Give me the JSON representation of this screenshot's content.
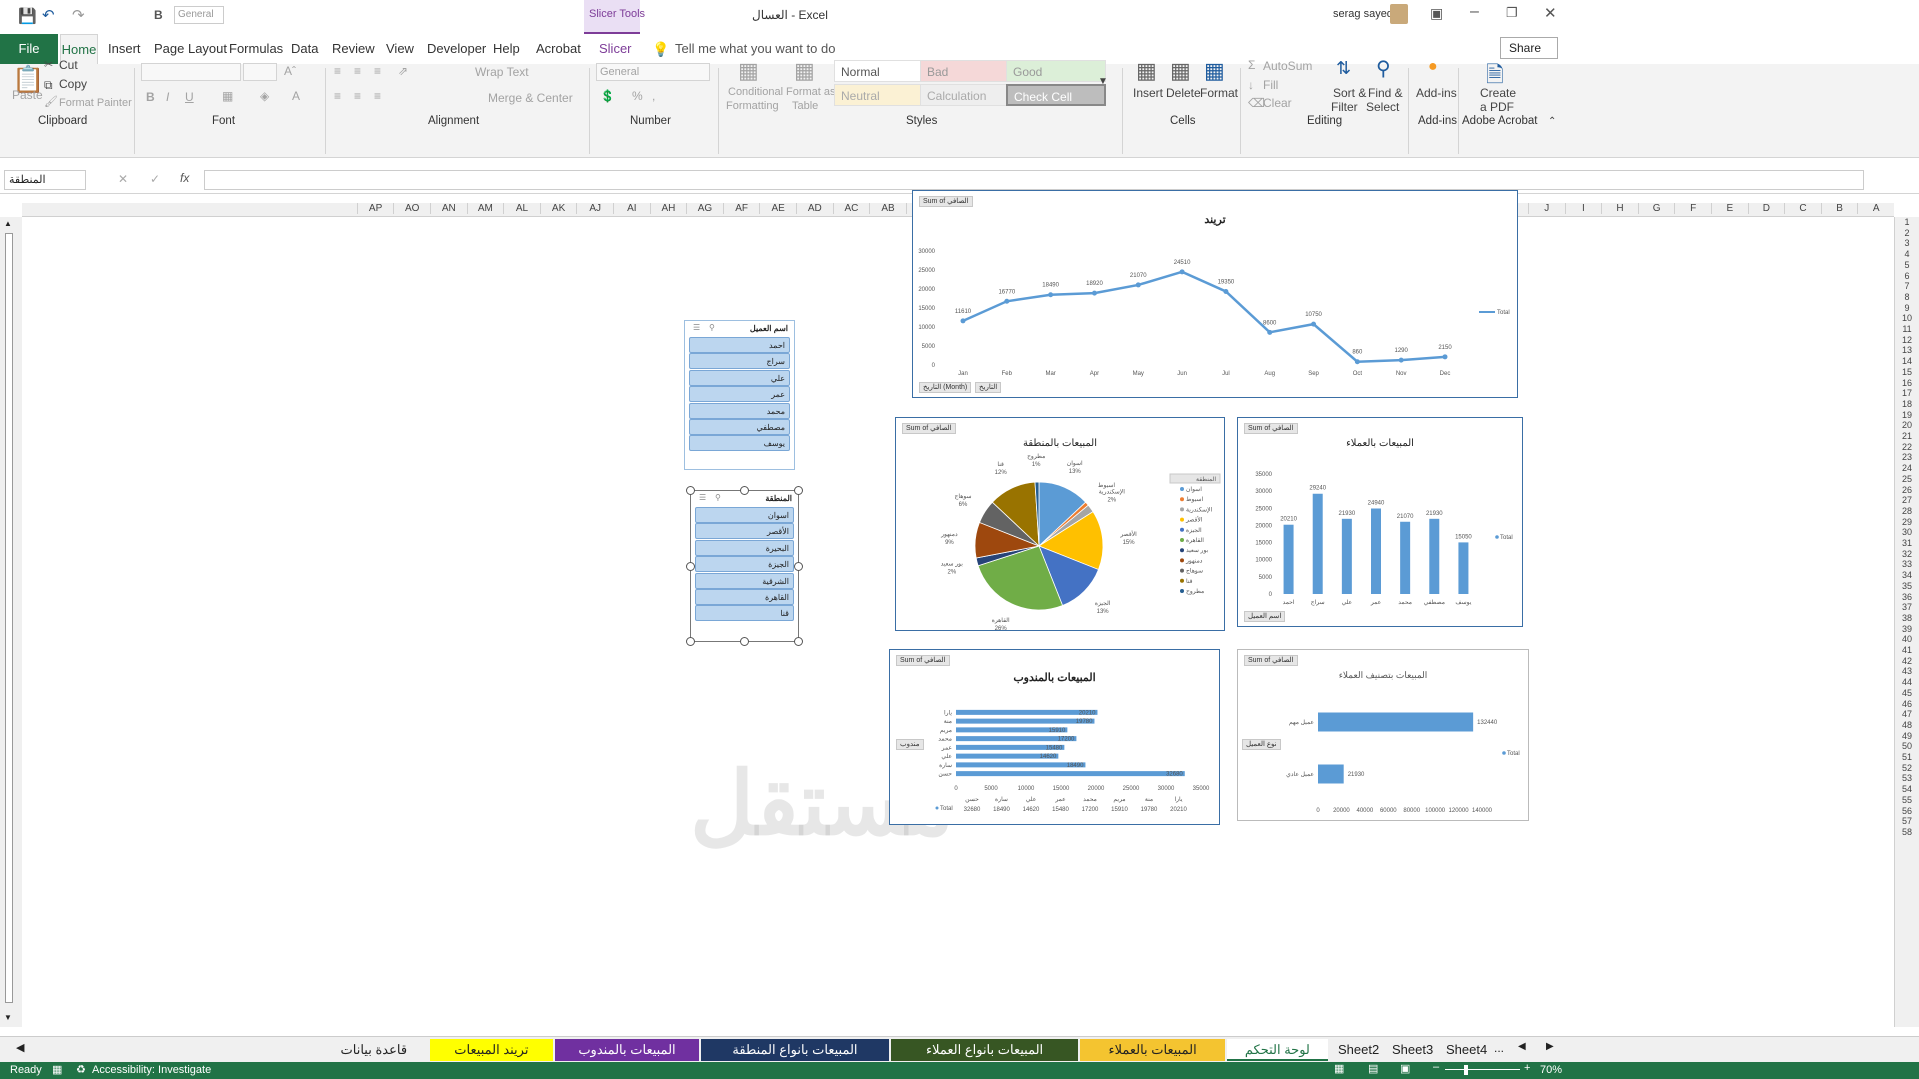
{
  "window": {
    "title": "العسال - Excel",
    "contextual": "Slicer Tools",
    "user": "serag sayed",
    "quick_font": "General"
  },
  "tabs": [
    "Home",
    "Insert",
    "Page Layout",
    "Formulas",
    "Data",
    "Review",
    "View",
    "Developer",
    "Help",
    "Acrobat",
    "Slicer"
  ],
  "file_tab": "File",
  "tell_me": "Tell me what you want to do",
  "share": "Share",
  "ribbon": {
    "clipboard": {
      "group": "Clipboard",
      "paste": "Paste",
      "cut": "Cut",
      "copy": "Copy",
      "painter": "Format Painter"
    },
    "font": {
      "group": "Font"
    },
    "alignment": {
      "group": "Alignment",
      "wrap": "Wrap Text",
      "merge": "Merge & Center"
    },
    "number": {
      "group": "Number",
      "format": "General"
    },
    "styles": {
      "group": "Styles",
      "cond": "Conditional",
      "cond2": "Formatting",
      "fmt_table": "Format as",
      "fmt_table2": "Table",
      "normal": "Normal",
      "bad": "Bad",
      "good": "Good",
      "neutral": "Neutral",
      "calculation": "Calculation",
      "check": "Check Cell"
    },
    "cells": {
      "group": "Cells",
      "insert": "Insert",
      "delete": "Delete",
      "format": "Format"
    },
    "editing": {
      "group": "Editing",
      "autosum": "AutoSum",
      "fill": "Fill",
      "clear": "Clear",
      "sort": "Sort &",
      "sort2": "Filter",
      "find": "Find &",
      "find2": "Select"
    },
    "addins": {
      "group": "Add-ins",
      "label": "Add-ins"
    },
    "acrobat": {
      "group": "Adobe Acrobat",
      "create": "Create",
      "create2": "a PDF"
    }
  },
  "namebox": "المنطقة",
  "columns": [
    "A",
    "B",
    "C",
    "D",
    "E",
    "F",
    "G",
    "H",
    "I",
    "J",
    "K",
    "L",
    "M",
    "N",
    "O",
    "P",
    "Q",
    "R",
    "S",
    "T",
    "U",
    "V",
    "W",
    "X",
    "Y",
    "Z",
    "AA",
    "AB",
    "AC",
    "AD",
    "AE",
    "AF",
    "AG",
    "AH",
    "AI",
    "AJ",
    "AK",
    "AL",
    "AM",
    "AN",
    "AO",
    "AP"
  ],
  "rows": [
    "1",
    "2",
    "3",
    "4",
    "5",
    "6",
    "7",
    "8",
    "9",
    "10",
    "11",
    "12",
    "13",
    "14",
    "15",
    "16",
    "17",
    "18",
    "19",
    "20",
    "21",
    "22",
    "23",
    "24",
    "25",
    "26",
    "27",
    "28",
    "29",
    "30",
    "31",
    "32",
    "33",
    "34",
    "35",
    "36",
    "37",
    "38",
    "39",
    "40",
    "41",
    "42",
    "43",
    "44",
    "45",
    "46",
    "47",
    "48",
    "49",
    "50",
    "51",
    "52",
    "53",
    "54",
    "55",
    "56",
    "57",
    "58"
  ],
  "slicers": [
    {
      "title": "اسم العميل",
      "items": [
        "احمد",
        "سراج",
        "علي",
        "عمر",
        "محمد",
        "مصطفي",
        "يوسف"
      ]
    },
    {
      "title": "المنطقة",
      "items": [
        "اسوان",
        "الأقصر",
        "البحيرة",
        "الجيزة",
        "الشرقية",
        "القاهرة",
        "قنا"
      ]
    }
  ],
  "chart_data": [
    {
      "type": "line",
      "title": "تريند",
      "field": "Sum of الصافي",
      "categories": [
        "Jan",
        "Feb",
        "Mar",
        "Apr",
        "May",
        "Jun",
        "Jul",
        "Aug",
        "Sep",
        "Oct",
        "Nov",
        "Dec"
      ],
      "series": [
        {
          "name": "Total",
          "values": [
            11610,
            16770,
            18490,
            18920,
            21070,
            24510,
            19350,
            8600,
            10750,
            860,
            1290,
            2150
          ]
        }
      ],
      "ylim": [
        0,
        30000
      ],
      "yticks": [
        "0",
        "5000",
        "10000",
        "15000",
        "20000",
        "25000",
        "30000"
      ],
      "filters": [
        "التاريخ (Month)",
        "التاريخ"
      ]
    },
    {
      "type": "pie",
      "title": "المبيعات بالمنطقة",
      "field": "Sum of الصافي",
      "legend_title": "المنطقة",
      "slices": [
        {
          "label": "اسوان",
          "value": 13
        },
        {
          "label": "اسيوط",
          "value": 1
        },
        {
          "label": "الإسكندرية",
          "value": 2
        },
        {
          "label": "الأقصر",
          "value": 15
        },
        {
          "label": "الجيزة",
          "value": 13
        },
        {
          "label": "القاهرة",
          "value": 26
        },
        {
          "label": "بور سعيد",
          "value": 2
        },
        {
          "label": "دمنهور",
          "value": 9
        },
        {
          "label": "سوهاج",
          "value": 6
        },
        {
          "label": "قنا",
          "value": 12
        },
        {
          "label": "مطروح",
          "value": 1
        }
      ],
      "colors": [
        "#5b9bd5",
        "#ed7d31",
        "#a5a5a5",
        "#ffc000",
        "#4472c4",
        "#70ad47",
        "#264478",
        "#9e480e",
        "#636363",
        "#997300",
        "#255e91"
      ],
      "legend": [
        "اسوان",
        "اسيوط",
        "الإسكندرية",
        "الأقصر",
        "الجيزة",
        "القاهرة",
        "بور سعيد",
        "دمنهور",
        "سوهاج",
        "قنا",
        "مطروح"
      ],
      "callouts": [
        {
          "name": "اسوان",
          "pct": "13%"
        },
        {
          "name": "اسيوط",
          "pct": ""
        },
        {
          "name": "الإسكندرية",
          "pct": "2%"
        },
        {
          "name": "الأقصر",
          "pct": "15%"
        },
        {
          "name": "الجيزة",
          "pct": "13%"
        },
        {
          "name": "القاهرة",
          "pct": "26%"
        },
        {
          "name": "بور سعيد",
          "pct": "2%"
        },
        {
          "name": "دمنهور",
          "pct": "9%"
        },
        {
          "name": "سوهاج",
          "pct": "6%"
        },
        {
          "name": "قنا",
          "pct": "12%"
        },
        {
          "name": "مطروح",
          "pct": "1%"
        }
      ]
    },
    {
      "type": "bar",
      "title": "المبيعات بالعملاء",
      "field": "Sum of الصافي",
      "categories": [
        "احمد",
        "سراج",
        "علي",
        "عمر",
        "محمد",
        "مصطفي",
        "يوسف"
      ],
      "series": [
        {
          "name": "Total",
          "values": [
            20210,
            29240,
            21930,
            24940,
            21070,
            21930,
            15050
          ]
        }
      ],
      "ylim": [
        0,
        35000
      ],
      "yticks": [
        "0",
        "5000",
        "10000",
        "15000",
        "20000",
        "25000",
        "30000",
        "35000"
      ],
      "filter": "اسم العميل"
    },
    {
      "type": "hbar",
      "title": "المبيعات بالمندوب",
      "field": "Sum of الصافي",
      "categories": [
        "حسن",
        "سارة",
        "علي",
        "عمر",
        "محمد",
        "مريم",
        "منة",
        "يارا"
      ],
      "series": [
        {
          "name": "Total",
          "values": [
            32680,
            18490,
            14620,
            15480,
            17200,
            15910,
            19780,
            20210
          ]
        }
      ],
      "xlim": [
        0,
        35000
      ],
      "xticks": [
        "0",
        "5000",
        "10000",
        "15000",
        "20000",
        "25000",
        "30000",
        "35000"
      ],
      "filter": "مندوب",
      "table_label": "Total",
      "table_values": [
        "32680",
        "18490",
        "14620",
        "15480",
        "17200",
        "15910",
        "19780",
        "20210"
      ]
    },
    {
      "type": "hbar",
      "title": "المبيعات بتصنيف العملاء",
      "field": "Sum of الصافي",
      "categories": [
        "عميل عادي",
        "عميل مهم"
      ],
      "series": [
        {
          "name": "Total",
          "values": [
            21930,
            132440
          ]
        }
      ],
      "xlim": [
        0,
        140000
      ],
      "xticks": [
        "0",
        "20000",
        "40000",
        "60000",
        "80000",
        "100000",
        "120000",
        "140000"
      ],
      "filter": "نوع العميل"
    }
  ],
  "sheets": [
    {
      "name": "لوحة التحكم",
      "color": "#ffffff",
      "active": true
    },
    {
      "name": "المبيعات بالعملاء",
      "color": "#f4c430"
    },
    {
      "name": "المبيعات بانواع العملاء",
      "color": "#375623"
    },
    {
      "name": "المبيعات بانواع المنطقة",
      "color": "#1f3864"
    },
    {
      "name": "المبيعات بالمندوب",
      "color": "#7030a0"
    },
    {
      "name": "تريند المبيعات",
      "color": "#ffff00"
    },
    {
      "name": "قاعدة بيانات",
      "color": "#f0f0f0"
    }
  ],
  "other_sheets": [
    "Sheet2",
    "Sheet3",
    "Sheet4"
  ],
  "status": {
    "ready": "Ready",
    "accessibility": "Accessibility: Investigate",
    "zoom": "70%"
  },
  "watermark": "مستقل"
}
